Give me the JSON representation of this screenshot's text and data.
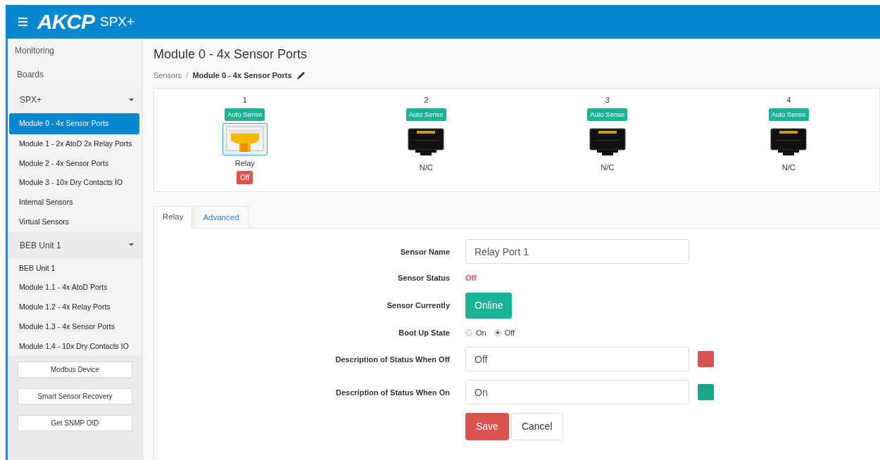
{
  "header": {
    "brand": "AKCP",
    "product": "SPX+"
  },
  "sidebar": {
    "heading": "Monitoring",
    "section": "Boards",
    "groups": [
      {
        "label": "SPX+",
        "expanded": true,
        "items": [
          {
            "label": "Module 0 - 4x Sensor Ports",
            "selected": true
          },
          {
            "label": "Module 1 - 2x AtoD 2x Relay Ports",
            "selected": false
          },
          {
            "label": "Module 2 - 4x Sensor Ports",
            "selected": false
          },
          {
            "label": "Module 3 - 10x Dry Contacts IO",
            "selected": false
          },
          {
            "label": "Internal Sensors",
            "selected": false
          },
          {
            "label": "Virtual Sensors",
            "selected": false
          }
        ]
      },
      {
        "label": "BEB Unit 1",
        "expanded": true,
        "items": [
          {
            "label": "BEB Unit 1",
            "selected": false
          },
          {
            "label": "Module 1.1 - 4x AtoD Ports",
            "selected": false
          },
          {
            "label": "Module 1.2 - 4x Relay Ports",
            "selected": false
          },
          {
            "label": "Module 1.3 - 4x Sensor Ports",
            "selected": false
          },
          {
            "label": "Module 1.4 - 10x Dry Contacts IO",
            "selected": false
          }
        ]
      }
    ],
    "buttons": [
      "Modbus Device",
      "Smart Sensor Recovery",
      "Get SNMP OID"
    ]
  },
  "page": {
    "title": "Module 0 - 4x Sensor Ports",
    "breadcrumb": [
      "Sensors",
      "Module 0 - 4x Sensor Ports"
    ],
    "breadcrumb_separator": "/"
  },
  "ports": [
    {
      "number": "1",
      "badge": "Auto Sense",
      "kind": "relay",
      "label": "Relay",
      "selected": true,
      "status": "Off"
    },
    {
      "number": "2",
      "badge": "Auto Sense",
      "kind": "empty",
      "label": "N/C",
      "selected": false
    },
    {
      "number": "3",
      "badge": "Auto Sense",
      "kind": "empty",
      "label": "N/C",
      "selected": false
    },
    {
      "number": "4",
      "badge": "Auto Sense",
      "kind": "empty",
      "label": "N/C",
      "selected": false
    }
  ],
  "tabs": [
    {
      "label": "Relay",
      "selected": true
    },
    {
      "label": "Advanced",
      "selected": false
    }
  ],
  "form": {
    "rows": [
      {
        "kind": "input",
        "label": "Sensor Name",
        "value": "Relay Port 1"
      },
      {
        "kind": "status",
        "label": "Sensor Status",
        "value": "Off"
      },
      {
        "kind": "button",
        "label": "Sensor Currently",
        "value": "Online"
      },
      {
        "kind": "radio",
        "label": "Boot Up State",
        "options": [
          {
            "label": "On",
            "selected": false
          },
          {
            "label": "Off",
            "selected": true
          }
        ]
      },
      {
        "kind": "input",
        "label": "Description of Status When Off",
        "value": "Off",
        "color": "#d9534f"
      },
      {
        "kind": "input",
        "label": "Description of Status When On",
        "value": "On",
        "color": "#16a689"
      }
    ],
    "buttons": [
      {
        "label": "Save",
        "kind": "primary"
      },
      {
        "label": "Cancel",
        "kind": "secondary"
      }
    ]
  }
}
